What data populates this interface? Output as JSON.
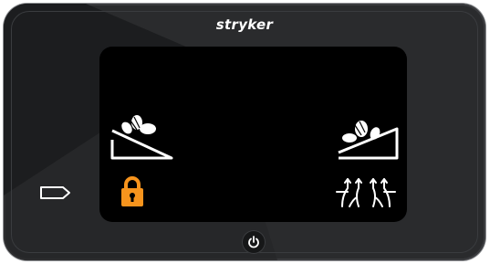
{
  "device": {
    "brand": "stryker",
    "frame_color": "#2a2b2d",
    "screen_color": "#000000",
    "accent_color": "#f7941d"
  },
  "screen": {
    "buttons": [
      {
        "icon": "head-elevation-low-icon"
      },
      {
        "icon": "head-elevation-high-icon"
      },
      {
        "icon": "lock-icon",
        "color": "#f7941d"
      },
      {
        "icon": "bed-exit-alarm-icon"
      }
    ]
  },
  "bezel": {
    "next_icon": "arrow-tag-icon",
    "power_icon": "power-icon"
  }
}
